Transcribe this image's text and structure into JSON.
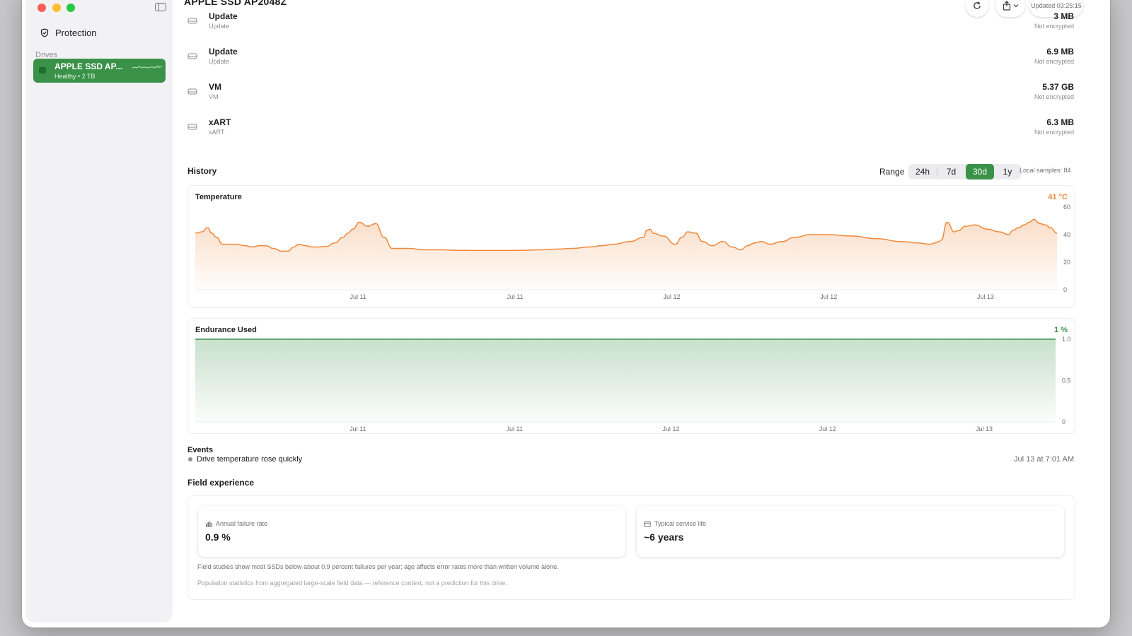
{
  "sidebar": {
    "nav_item": "Protection",
    "section_label": "Drives",
    "drive": {
      "name": "APPLE SSD AP...",
      "status": "Healthy",
      "capacity": "2 TB"
    }
  },
  "header": {
    "title": "APPLE SSD AP2048Z",
    "updated": "Updated 03:25:15"
  },
  "volumes": [
    {
      "name": "Update",
      "subtitle": "Update",
      "size": "3 MB",
      "encryption": "Not encrypted"
    },
    {
      "name": "Update",
      "subtitle": "Update",
      "size": "6.9 MB",
      "encryption": "Not encrypted"
    },
    {
      "name": "VM",
      "subtitle": "VM",
      "size": "5.37 GB",
      "encryption": "Not encrypted"
    },
    {
      "name": "xART",
      "subtitle": "xART",
      "size": "6.3 MB",
      "encryption": "Not encrypted"
    }
  ],
  "history": {
    "title": "History",
    "range_label": "Range",
    "ranges": [
      "24h",
      "7d",
      "30d",
      "1y"
    ],
    "selected_range": "30d",
    "samples": "Local samples: 84"
  },
  "colors": {
    "accent": "#3a9249",
    "temperature": "#f0883a",
    "endurance": "#3a9249"
  },
  "chart_data": [
    {
      "type": "area",
      "title": "Temperature",
      "current_value": "41 °C",
      "x_tick_labels": [
        "Jul 11",
        "Jul 11",
        "Jul 12",
        "Jul 12",
        "Jul 13"
      ],
      "y_tick_labels": [
        "0",
        "20",
        "40",
        "60"
      ],
      "ylim": [
        0,
        60
      ],
      "grid": false,
      "x": [
        0,
        0.8,
        1.5,
        2,
        2.6,
        3.3,
        4,
        5,
        6,
        7,
        7.8,
        8.6,
        9.5,
        10.5,
        11.3,
        12,
        12.6,
        13.4,
        14.2,
        15,
        16,
        17,
        18,
        18.6,
        19.2,
        20,
        21,
        22,
        23,
        24,
        26,
        28,
        30,
        32,
        34,
        36,
        38,
        40,
        42,
        44,
        46,
        48,
        49.5,
        51,
        53,
        54.6,
        55,
        55.4,
        55.8,
        57,
        58.5,
        59.3,
        60,
        61,
        61.8,
        63,
        64.3,
        65.4,
        66.5,
        67.3,
        68.2,
        69,
        70,
        71.5,
        73,
        75,
        77,
        80,
        83,
        86,
        88,
        89.5,
        90.2,
        90.6,
        90.9,
        91.6,
        92.5,
        93,
        93.8,
        95,
        96.5,
        98,
        99.1,
        99.6,
        100.3,
        101,
        101.6,
        102.2,
        102.9,
        103.6,
        104.2,
        105
      ],
      "y": [
        41,
        42,
        45,
        41,
        38,
        33,
        33,
        33,
        32,
        31,
        32,
        32,
        30,
        28,
        28,
        31,
        33,
        32,
        31,
        31,
        31.5,
        34,
        38,
        41,
        44,
        49,
        46,
        48,
        38,
        30,
        30,
        29,
        29,
        28.6,
        28.5,
        28.5,
        28.5,
        28.6,
        29,
        29.5,
        30,
        31,
        32,
        33,
        35,
        38,
        43,
        44,
        41,
        39,
        33,
        38,
        42,
        41,
        35,
        32,
        35,
        31,
        29,
        32,
        34,
        35,
        33,
        35,
        38,
        40,
        40,
        39,
        37,
        35,
        34,
        33,
        34,
        35,
        36,
        49,
        42,
        43,
        46,
        47,
        44,
        42,
        40,
        43,
        45,
        47,
        49,
        51,
        48,
        47,
        45,
        41
      ]
    },
    {
      "type": "area",
      "title": "Endurance Used",
      "current_value": "1 %",
      "x_tick_labels": [
        "Jul 11",
        "Jul 11",
        "Jul 12",
        "Jul 12",
        "Jul 13"
      ],
      "y_tick_labels": [
        "0",
        "0.5",
        "1.0"
      ],
      "ylim": [
        0,
        1
      ],
      "grid": false,
      "x": [
        0,
        105
      ],
      "y": [
        1,
        1
      ]
    }
  ],
  "events": {
    "title": "Events",
    "items": [
      {
        "text": "Drive temperature rose quickly",
        "time": "Jul 13 at 7:01 AM"
      }
    ]
  },
  "field_experience": {
    "title": "Field experience",
    "stats": [
      {
        "icon": "bar-chart-icon",
        "label": "Annual failure rate",
        "value": "0.9 %"
      },
      {
        "icon": "calendar-icon",
        "label": "Typical service life",
        "value": "~6 years"
      }
    ],
    "note": "Field studies show most SSDs below about 0.9 percent failures per year; age affects error rates more than written volume alone.",
    "source": "Population statistics from aggregated large-scale field data — reference context, not a prediction for this drive."
  }
}
